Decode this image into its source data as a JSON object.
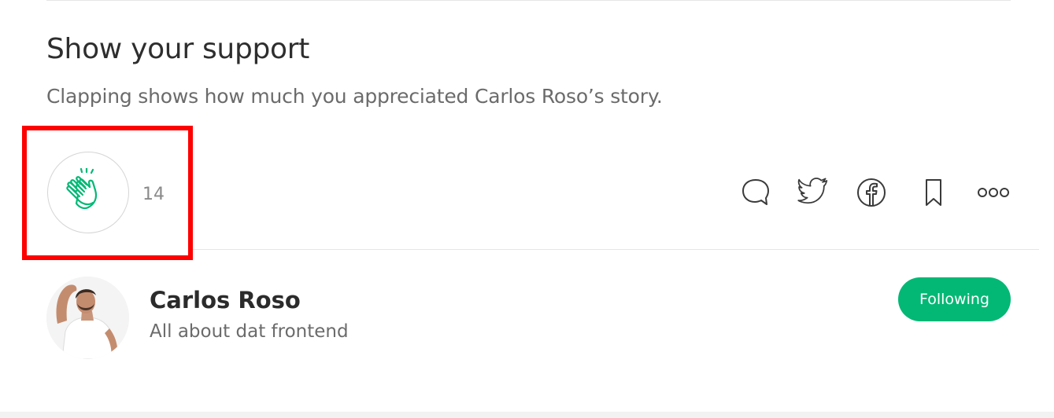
{
  "support": {
    "heading": "Show your support",
    "subheading": "Clapping shows how much you appreciated Carlos Roso’s story."
  },
  "clap": {
    "count": "14",
    "icon": "clap-icon",
    "accent_color": "#03b875"
  },
  "actions": {
    "icons": [
      "comment-icon",
      "twitter-icon",
      "facebook-icon",
      "bookmark-icon",
      "more-icon"
    ]
  },
  "author": {
    "name": "Carlos Roso",
    "bio": "All about dat frontend",
    "follow_label": "Following"
  },
  "colors": {
    "highlight": "#ff0000",
    "follow_button": "#03b875"
  }
}
